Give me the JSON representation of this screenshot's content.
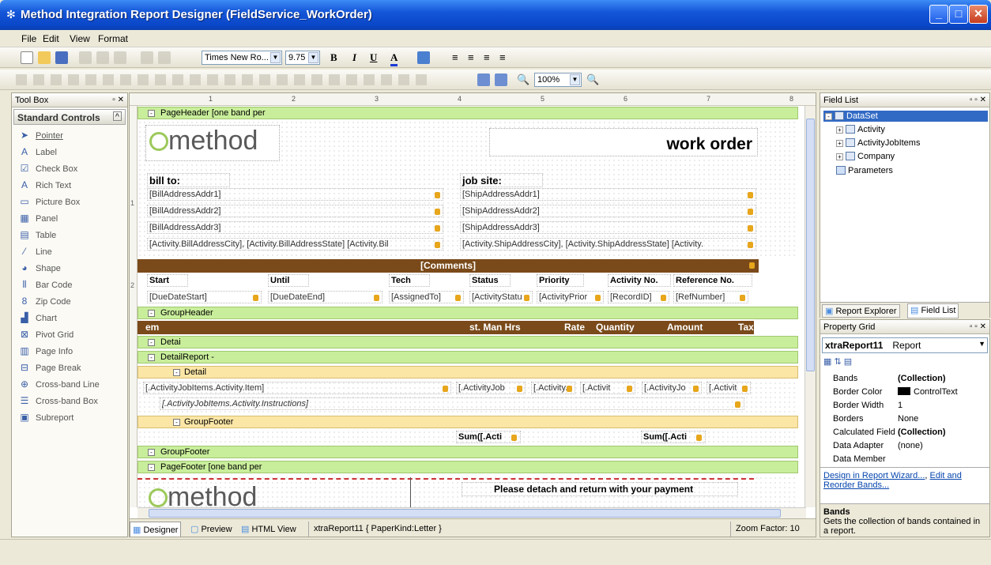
{
  "window": {
    "title": "Method Integration Report Designer (FieldService_WorkOrder)"
  },
  "menu": [
    "File",
    "Edit",
    "View",
    "Format"
  ],
  "format_toolbar": {
    "font": "Times New Ro...",
    "size": "9.75",
    "bold": "B",
    "italic": "I",
    "underline": "U"
  },
  "layout_toolbar": {
    "zoom": "100%"
  },
  "toolbox": {
    "title": "Tool Box",
    "section": "Standard Controls",
    "items": [
      {
        "label": "Pointer",
        "icon": "pointer-icon",
        "glyph": "➤"
      },
      {
        "label": "Label",
        "icon": "label-icon",
        "glyph": "A"
      },
      {
        "label": "Check Box",
        "icon": "checkbox-icon",
        "glyph": "☑"
      },
      {
        "label": "Rich Text",
        "icon": "rich-text-icon",
        "glyph": "A"
      },
      {
        "label": "Picture Box",
        "icon": "picture-box-icon",
        "glyph": "▭"
      },
      {
        "label": "Panel",
        "icon": "panel-icon",
        "glyph": "▦"
      },
      {
        "label": "Table",
        "icon": "table-icon",
        "glyph": "▤"
      },
      {
        "label": "Line",
        "icon": "line-icon",
        "glyph": "⁄"
      },
      {
        "label": "Shape",
        "icon": "shape-icon",
        "glyph": "◕"
      },
      {
        "label": "Bar Code",
        "icon": "barcode-icon",
        "glyph": "⦀"
      },
      {
        "label": "Zip Code",
        "icon": "zipcode-icon",
        "glyph": "8"
      },
      {
        "label": "Chart",
        "icon": "chart-icon",
        "glyph": "▟"
      },
      {
        "label": "Pivot Grid",
        "icon": "pivot-grid-icon",
        "glyph": "⊠"
      },
      {
        "label": "Page Info",
        "icon": "page-info-icon",
        "glyph": "▥"
      },
      {
        "label": "Page Break",
        "icon": "page-break-icon",
        "glyph": "⊟"
      },
      {
        "label": "Cross-band Line",
        "icon": "cross-band-line-icon",
        "glyph": "⊕"
      },
      {
        "label": "Cross-band Box",
        "icon": "cross-band-box-icon",
        "glyph": "☰"
      },
      {
        "label": "Subreport",
        "icon": "subreport-icon",
        "glyph": "▣"
      }
    ]
  },
  "ruler": [
    "1",
    "2",
    "3",
    "4",
    "5",
    "6",
    "7",
    "8"
  ],
  "vruler": [
    "1",
    "2"
  ],
  "report": {
    "page_header": "PageHeader [one band per",
    "logo": "method",
    "work_order": "work order",
    "bill_to": "bill to:",
    "job_site": "job site:",
    "bill_fields": [
      "[BillAddressAddr1]",
      "[BillAddressAddr2]",
      "[BillAddressAddr3]",
      "[Activity.BillAddressCity], [Activity.BillAddressState] [Activity.Bil"
    ],
    "ship_fields": [
      "[ShipAddressAddr1]",
      "[ShipAddressAddr2]",
      "[ShipAddressAddr3]",
      "[Activity.ShipAddressCity], [Activity.ShipAddressState] [Activity."
    ],
    "comments": "[Comments]",
    "columns": [
      "Start",
      "Until",
      "Tech",
      "Status",
      "Priority",
      "Activity No.",
      "Reference No."
    ],
    "values": [
      "[DueDateStart]",
      "[DueDateEnd]",
      "[AssignedTo]",
      "[ActivityStatu",
      "[ActivityPrior",
      "[RecordID]",
      "[RefNumber]"
    ],
    "group_header": "GroupHeader",
    "item_header": [
      "em",
      "st. Man Hrs",
      "Rate",
      "Quantity",
      "Amount",
      "Tax"
    ],
    "detail": "Detai",
    "detail_report": "DetailReport -",
    "detail_inner": "Detail",
    "item_row": [
      "[.ActivityJobItems.Activity.Item]",
      "[.ActivityJob",
      "[.Activity.",
      "[.Activit",
      "[.ActivityJo",
      "[.Activit"
    ],
    "instructions": "[.ActivityJobItems.Activity.Instructions]",
    "group_footer_inner": "GroupFooter",
    "sums": [
      "Sum([.Acti",
      "Sum([.Acti"
    ],
    "group_footer": "GroupFooter",
    "page_footer": "PageFooter [one band per",
    "detach": "Please detach and return with your payment"
  },
  "bottom_tabs": {
    "designer": "Designer",
    "preview": "Preview",
    "html": "HTML View",
    "report": "xtraReport11 { PaperKind:Letter }",
    "zoom": "Zoom Factor: 10"
  },
  "field_list": {
    "title": "Field List",
    "root": "DataSet",
    "items": [
      "Activity",
      "ActivityJobItems",
      "Company"
    ],
    "parameters": "Parameters",
    "tab_explorer": "Report Explorer",
    "tab_fields": "Field List"
  },
  "property_grid": {
    "title": "Property Grid",
    "object": "xtraReport11",
    "type": "Report",
    "rows": [
      {
        "k": "Bands",
        "v": "(Collection)",
        "bold": true
      },
      {
        "k": "Border Color",
        "v": "ControlText",
        "bold": false
      },
      {
        "k": "Border Width",
        "v": "1",
        "bold": false
      },
      {
        "k": "Borders",
        "v": "None",
        "bold": false
      },
      {
        "k": "Calculated Field",
        "v": "(Collection)",
        "bold": true
      },
      {
        "k": "Data Adapter",
        "v": "(none)",
        "bold": false
      },
      {
        "k": "Data Member",
        "v": "",
        "bold": false
      }
    ],
    "link1": "Design in Report Wizard...",
    "link_sep": ", ",
    "link2": "Edit and Reorder Bands...",
    "desc_title": "Bands",
    "desc_text": "Gets the collection of bands contained in a report."
  }
}
